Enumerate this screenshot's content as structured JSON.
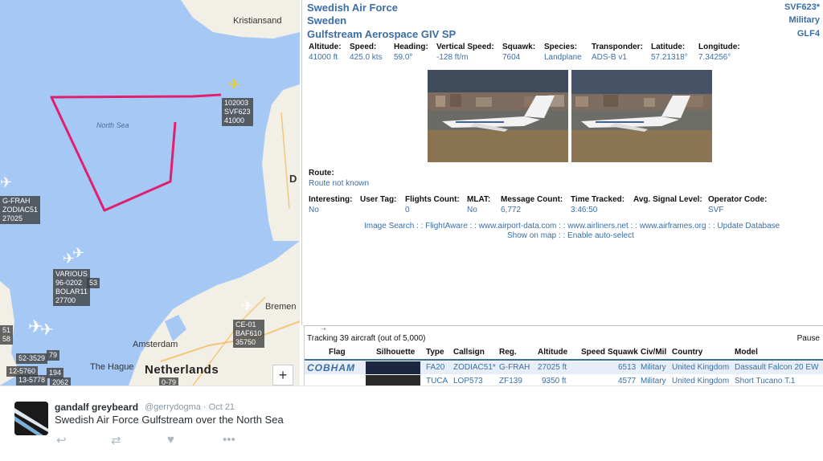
{
  "map": {
    "places": {
      "kristiansand": "Kristiansand",
      "north_sea": "North Sea",
      "bremen": "Bremen",
      "amsterdam": "Amsterdam",
      "the_hague": "The Hague",
      "netherlands": "Netherlands",
      "d": "D"
    },
    "labels": {
      "svf623": "102003\nSVF623\n41000",
      "frah": "G-FRAH\nZODIAC51\n27025",
      "various": "VARIOUS\n96-0202\nBOLAR11\n27700",
      "various_num": "53",
      "ce01": "CE-01\nBAF610\n35750",
      "left1": "51\n58",
      "c1": "52-3529",
      "c2": "79",
      "c3": "12-5760",
      "c4": "13-5778",
      "c5": "194",
      "c6": "2062",
      "c7": "0-79"
    },
    "zoom_in": "+"
  },
  "aircraft": {
    "operator": "Swedish Air Force",
    "country": "Sweden",
    "type_name": "Gulfstream Aerospace GIV SP",
    "callsign": "SVF623*",
    "category": "Military",
    "type_code": "GLF4"
  },
  "fields_row1": [
    {
      "label": "Altitude:",
      "value": "41000 ft"
    },
    {
      "label": "Speed:",
      "value": "425.0 kts"
    },
    {
      "label": "Heading:",
      "value": "59.0°"
    },
    {
      "label": "Vertical Speed:",
      "value": "-128 ft/m"
    },
    {
      "label": "Squawk:",
      "value": "7604"
    },
    {
      "label": "Species:",
      "value": "Landplane"
    },
    {
      "label": "Transponder:",
      "value": "ADS-B v1"
    },
    {
      "label": "Latitude:",
      "value": "57.21318°"
    },
    {
      "label": "Longitude:",
      "value": "7.34256°"
    }
  ],
  "route": {
    "label": "Route:",
    "value": "Route not known"
  },
  "fields_row2": [
    {
      "label": "Interesting:",
      "value": "No"
    },
    {
      "label": "User Tag:",
      "value": ""
    },
    {
      "label": "Flights Count:",
      "value": "0"
    },
    {
      "label": "MLAT:",
      "value": "No"
    },
    {
      "label": "Message Count:",
      "value": "6,772"
    },
    {
      "label": "Time Tracked:",
      "value": "3:46:50"
    },
    {
      "label": "Avg. Signal Level:",
      "value": ""
    },
    {
      "label": "Operator Code:",
      "value": "SVF"
    }
  ],
  "links": {
    "line1": "Image Search : : FlightAware : : www.airport-data.com : : www.airliners.net : : www.airframes.org : : Update Database",
    "line2": "Show on map : : Enable auto-select"
  },
  "tracking": {
    "status": "Tracking 39 aircraft (out of 5,000)",
    "pause": "Pause",
    "columns": [
      "Flag",
      "Silhouette",
      "Type",
      "Callsign",
      "Reg.",
      "Altitude",
      "Speed",
      "Squawk",
      "Civ/Mil",
      "Country",
      "Model"
    ],
    "rows": [
      {
        "flag": "COBHAM",
        "type": "FA20",
        "callsign": "ZODIAC51*",
        "reg": "G-FRAH",
        "altitude": "27025 ft",
        "speed": "",
        "squawk": "6513",
        "civmil": "Military",
        "country": "United Kingdom",
        "model": "Dassault Falcon 20 EW"
      },
      {
        "flag": "",
        "type": "TUCA",
        "callsign": "LOP573",
        "reg": "ZF139",
        "altitude": "9350 ft",
        "speed": "",
        "squawk": "4577",
        "civmil": "Military",
        "country": "United Kingdom",
        "model": "Short Tucano T.1"
      }
    ]
  },
  "tweet": {
    "name": "gandalf greybeard",
    "handle": "@gerrydogma · Oct 21",
    "text": "Swedish Air Force Gulfstream over the North Sea"
  },
  "colors": {
    "accent": "#3a6ea5",
    "track": "#e0206e",
    "sea": "#a6c8f4",
    "land": "#f2efe6"
  }
}
